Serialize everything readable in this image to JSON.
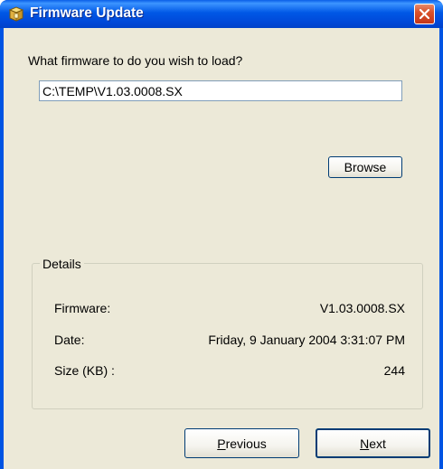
{
  "window": {
    "title": "Firmware Update",
    "title_icon": "firmware-package-icon",
    "close_icon": "close-icon"
  },
  "prompt": "What firmware to do you wish to load?",
  "firmware_path": {
    "value": "C:\\TEMP\\V1.03.0008.SX"
  },
  "buttons": {
    "browse": "Browse",
    "previous_accel": "P",
    "previous_rest": "revious",
    "next_accel": "N",
    "next_rest": "ext"
  },
  "details": {
    "legend": "Details",
    "rows": [
      {
        "label": "Firmware:",
        "value": "V1.03.0008.SX"
      },
      {
        "label": "Date:",
        "value": "Friday, 9 January 2004 3:31:07 PM"
      },
      {
        "label": "Size (KB) :",
        "value": "244"
      }
    ]
  },
  "colors": {
    "titlebar": "#0058e6",
    "dialog_background": "#ece9d8",
    "close_button": "#d9522b",
    "button_border": "#003c74"
  }
}
